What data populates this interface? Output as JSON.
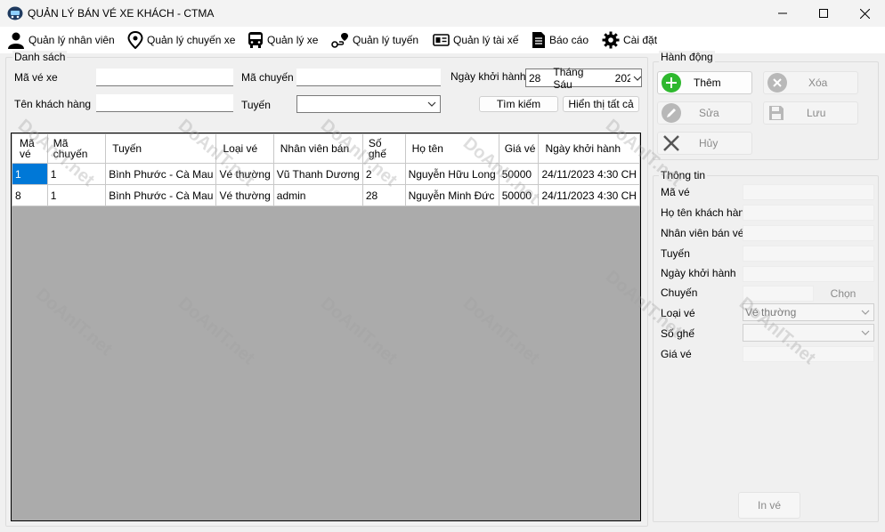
{
  "window": {
    "title": "QUẢN LÝ BÁN VÉ XE KHÁCH - CTMA"
  },
  "menu": {
    "items": [
      {
        "label": "Quản lý nhân viên",
        "icon": "user-icon"
      },
      {
        "label": "Quản lý chuyến xe",
        "icon": "map-pin-icon"
      },
      {
        "label": "Quản lý xe",
        "icon": "bus-icon"
      },
      {
        "label": "Quản lý tuyến",
        "icon": "route-icon"
      },
      {
        "label": "Quản lý tài xế",
        "icon": "id-card-icon"
      },
      {
        "label": "Báo cáo",
        "icon": "report-icon"
      },
      {
        "label": "Cài đặt",
        "icon": "gear-icon"
      }
    ]
  },
  "search": {
    "group_title": "Danh sách",
    "ticket_id_label": "Mã vé xe",
    "ticket_id_value": "",
    "trip_id_label": "Mã chuyến",
    "trip_id_value": "",
    "departure_label": "Ngày khởi hành",
    "departure_day": "28",
    "departure_month": "Tháng Sáu",
    "departure_year": "202",
    "customer_label": "Tên khách hàng",
    "customer_value": "",
    "route_label": "Tuyến",
    "route_value": "",
    "search_button": "Tìm kiếm",
    "show_all_button": "Hiển thị tất cả"
  },
  "table": {
    "columns": [
      "Mã vé",
      "Mã chuyến",
      "Tuyến",
      "Loại vé",
      "Nhân viên bán",
      "Số ghế",
      "Họ tên",
      "Giá vé",
      "Ngày khởi hành"
    ],
    "rows": [
      [
        "1",
        "1",
        "Bình Phước - Cà Mau",
        "Vé thường",
        "Vũ Thanh Dương",
        "2",
        "Nguyễn Hữu Long",
        "50000",
        "24/11/2023 4:30 CH"
      ],
      [
        "8",
        "1",
        "Bình Phước - Cà Mau",
        "Vé thường",
        "admin",
        "28",
        "Nguyễn Minh Đức",
        "50000",
        "24/11/2023 4:30 CH"
      ]
    ]
  },
  "actions": {
    "group_title": "Hành động",
    "add": "Thêm",
    "delete": "Xóa",
    "edit": "Sửa",
    "save": "Lưu",
    "cancel": "Hủy"
  },
  "info": {
    "group_title": "Thông tin",
    "ticket_id_label": "Mã vé",
    "customer_label": "Họ tên khách hàng",
    "seller_label": "Nhân viên bán vé",
    "route_label": "Tuyến",
    "departure_label": "Ngày khởi hành",
    "trip_label": "Chuyến",
    "choose_button": "Chọn",
    "ticket_type_label": "Loại vé",
    "ticket_type_value": "Vé thường",
    "seat_label": "Số ghế",
    "price_label": "Giá vé",
    "print_button": "In vé"
  },
  "watermark": "DoAnIT.net",
  "colors": {
    "selection": "#0078d7",
    "add_icon": "#2eb82e",
    "window_bg": "#f0f0f0"
  }
}
